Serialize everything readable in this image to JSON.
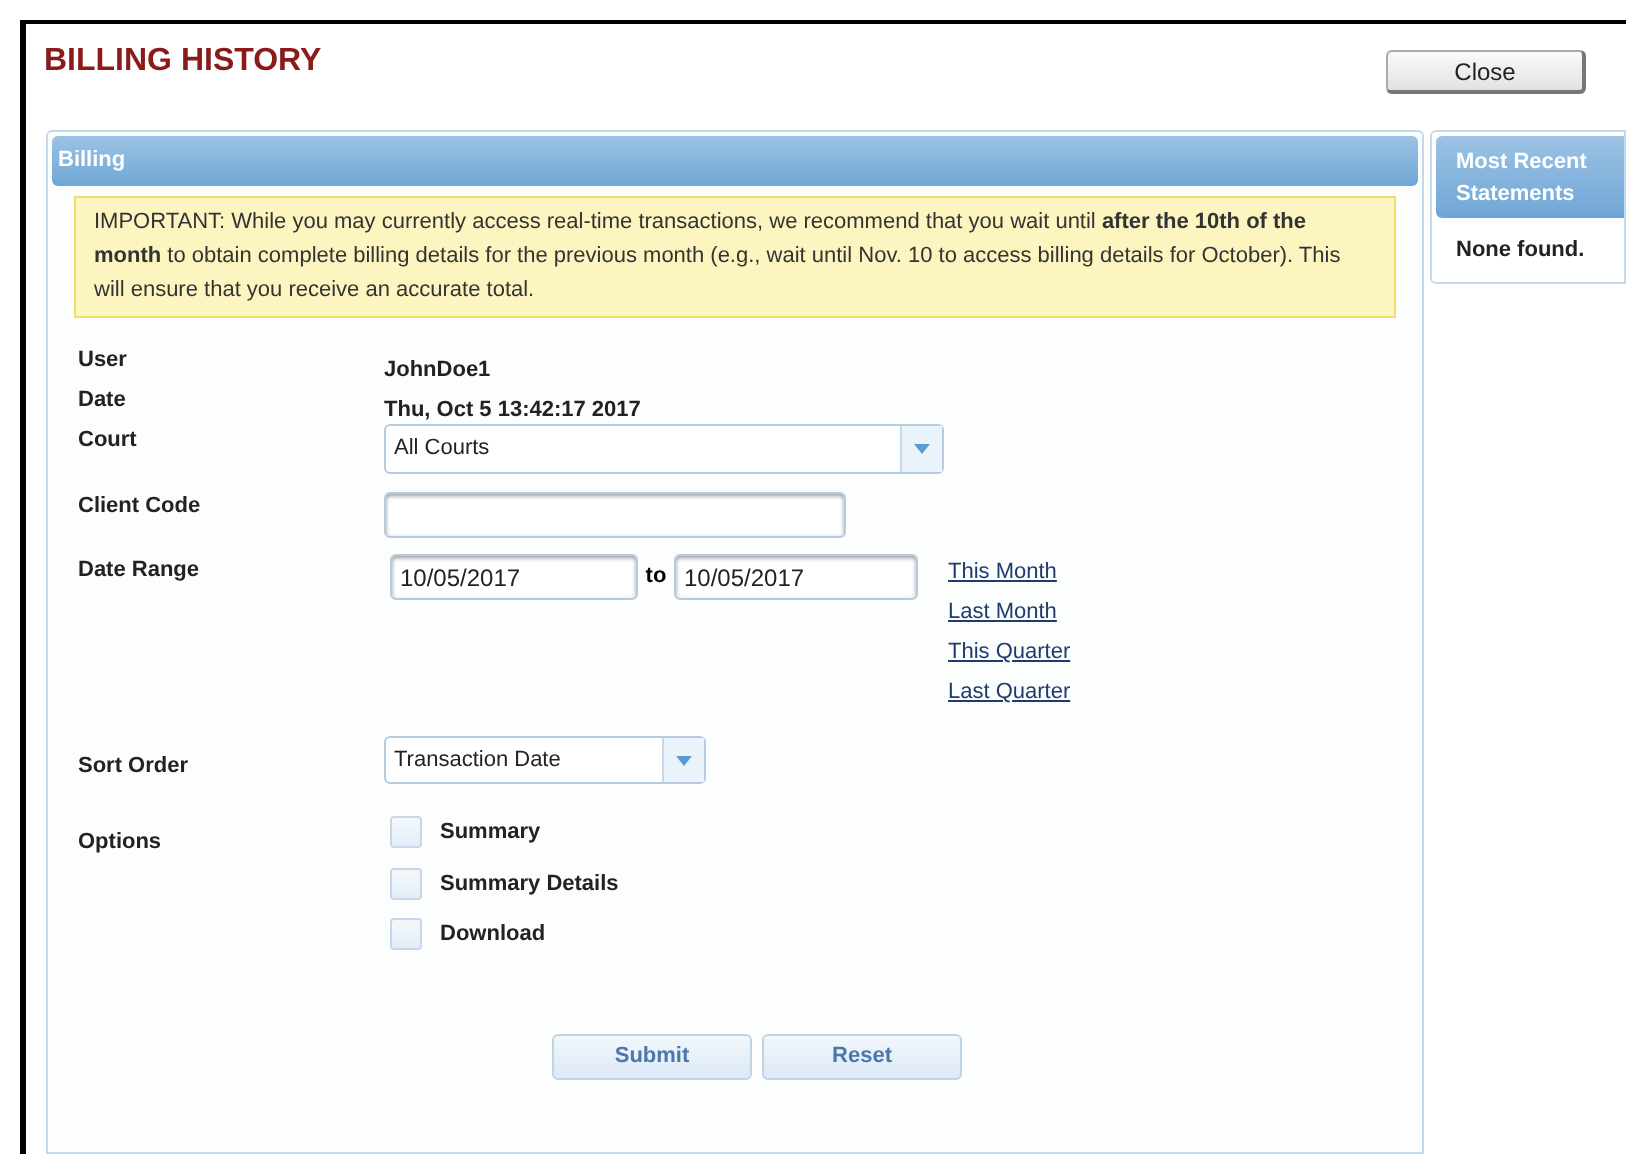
{
  "title": "BILLING HISTORY",
  "close_button": "Close",
  "billing_panel": {
    "title": "Billing",
    "notice": "IMPORTANT: While you may currently access real-time transactions, we recommend that you wait until **after the 10th of the month** to obtain complete billing details for the previous month (e.g., wait until Nov. 10 to access billing details for October). This will ensure that you receive an accurate total.",
    "user": {
      "label": "User",
      "value": "JohnDoe1"
    },
    "date": {
      "label": "Date",
      "value": "Thu, Oct 5 13:42:17 2017"
    },
    "court": {
      "label": "Court",
      "value": "All Courts"
    },
    "client_code": {
      "label": "Client Code"
    },
    "date_range": {
      "label": "Date Range",
      "from": "10/05/2017",
      "separator": "to",
      "to": "10/05/2017",
      "shortcuts": [
        "This Month",
        "Last Month",
        "This Quarter",
        "Last Quarter"
      ]
    },
    "sort_order": {
      "label": "Sort Order",
      "value": "Transaction Date"
    },
    "options": {
      "label": "Options",
      "items": [
        {
          "label": "Summary",
          "checked": false
        },
        {
          "label": "Summary Details",
          "checked": false
        },
        {
          "label": "Download",
          "checked": false
        }
      ]
    },
    "buttons": [
      "Submit",
      "Reset"
    ]
  },
  "statements_panel": {
    "title": "Most Recent Statements",
    "message": "None found."
  }
}
